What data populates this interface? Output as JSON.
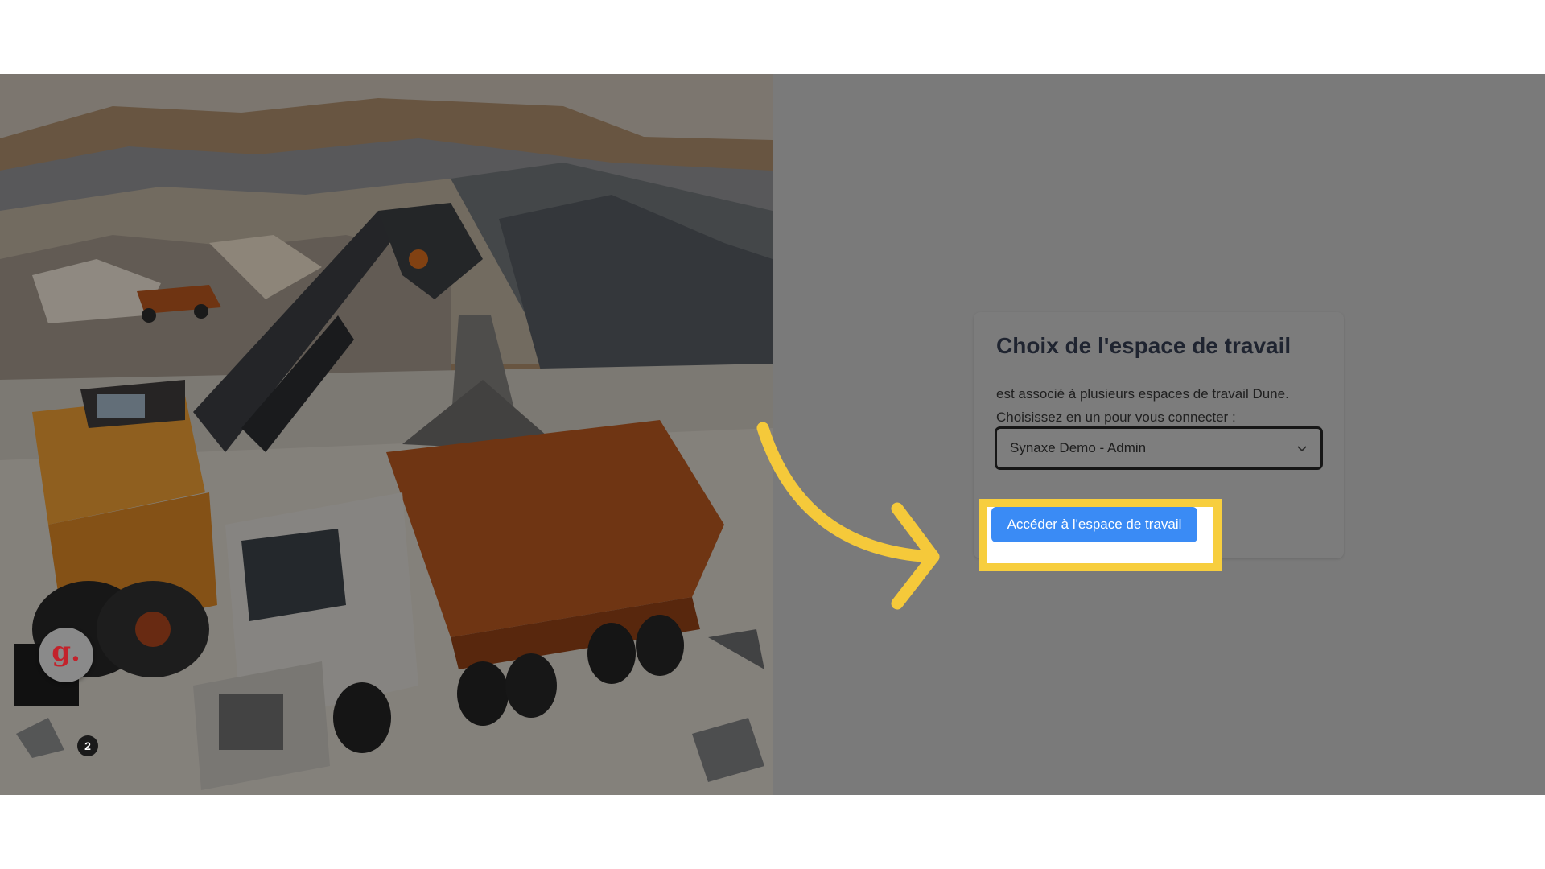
{
  "card": {
    "title": "Choix de l'espace de travail",
    "description_line1": "est associé à plusieurs espaces de travail Dune.",
    "description_line2": "Choisissez en un pour vous connecter :",
    "workspace_select": {
      "value": "Synaxe Demo - Admin"
    },
    "submit_label": "Accéder à l'espace de travail"
  },
  "guide_widget": {
    "logo": "g.",
    "badge_count": "2"
  },
  "colors": {
    "accent_button": "#3a8bf5",
    "highlight": "#f7ce3e",
    "overlay": "#7a7a7a"
  },
  "icons": {
    "select_chevron": "chevron-down-icon",
    "callout_arrow": "arrow-right-icon"
  }
}
